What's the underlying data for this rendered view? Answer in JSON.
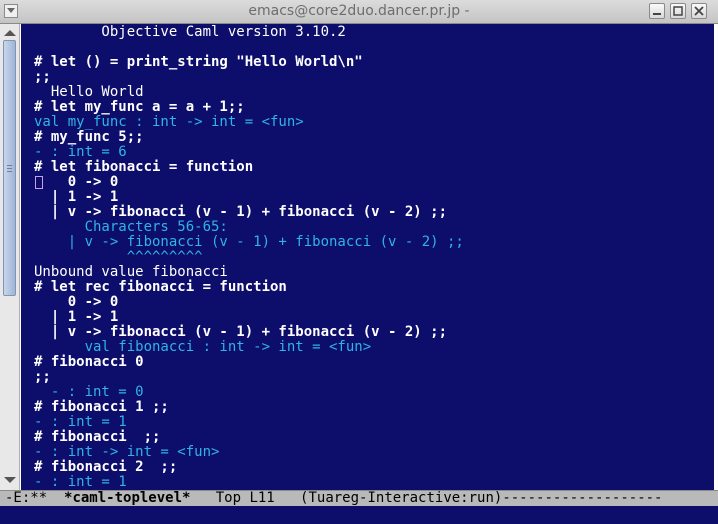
{
  "window": {
    "title": "emacs@core2duo.dancer.pr.jp -"
  },
  "buffer": {
    "lines": [
      {
        "text": "        Objective Caml version 3.10.2",
        "kind": "out"
      },
      {
        "text": "",
        "kind": "out"
      },
      {
        "text": "# let () = print_string \"Hello World\\n\"",
        "kind": "inp"
      },
      {
        "text": ";;",
        "kind": "inp"
      },
      {
        "text": "  Hello World",
        "kind": "out"
      },
      {
        "text": "# let my_func a = a + 1;;",
        "kind": "inp"
      },
      {
        "text": "val my_func : int -> int = <fun>",
        "kind": "typ"
      },
      {
        "text": "# my_func 5;;",
        "kind": "inp"
      },
      {
        "text": "- : int = 6",
        "kind": "typ"
      },
      {
        "text": "# let fibonacci = function",
        "kind": "inp"
      },
      {
        "text": "    0 -> 0",
        "kind": "inp"
      },
      {
        "text": "  | 1 -> 1",
        "kind": "inp"
      },
      {
        "text": "  | v -> fibonacci (v - 1) + fibonacci (v - 2) ;;",
        "kind": "inp"
      },
      {
        "text": "      Characters 56-65:",
        "kind": "typ"
      },
      {
        "text": "    | v -> fibonacci (v - 1) + fibonacci (v - 2) ;;",
        "kind": "typ"
      },
      {
        "text": "           ^^^^^^^^^",
        "kind": "typ"
      },
      {
        "text": "Unbound value fibonacci",
        "kind": "out"
      },
      {
        "text": "# let rec fibonacci = function",
        "kind": "inp"
      },
      {
        "text": "    0 -> 0",
        "kind": "inp"
      },
      {
        "text": "  | 1 -> 1",
        "kind": "inp"
      },
      {
        "text": "  | v -> fibonacci (v - 1) + fibonacci (v - 2) ;;",
        "kind": "inp"
      },
      {
        "text": "      val fibonacci : int -> int = <fun>",
        "kind": "typ"
      },
      {
        "text": "# fibonacci 0",
        "kind": "inp"
      },
      {
        "text": ";;",
        "kind": "inp"
      },
      {
        "text": "  - : int = 0",
        "kind": "typ"
      },
      {
        "text": "# fibonacci 1 ;;",
        "kind": "inp"
      },
      {
        "text": "- : int = 1",
        "kind": "typ"
      },
      {
        "text": "# fibonacci  ;;",
        "kind": "inp"
      },
      {
        "text": "- : int -> int = <fun>",
        "kind": "typ"
      },
      {
        "text": "# fibonacci 2  ;;",
        "kind": "inp"
      },
      {
        "text": "- : int = 1",
        "kind": "typ"
      }
    ]
  },
  "modeline": {
    "flags": "-E:**  ",
    "buffer_name": "*caml-toplevel*",
    "position": "   Top L11   ",
    "mode": "(Tuareg-Interactive:run)",
    "fill": "-------------------"
  },
  "minibuffer": {
    "text": ""
  },
  "colors": {
    "background": "#0d0d6b",
    "foreground": "#ffffff",
    "type_output": "#2fb4e6",
    "modeline_bg": "#b9b9b9"
  },
  "icons": [
    "window-menu-icon",
    "minimize-icon",
    "maximize-icon",
    "close-icon",
    "scroll-up-icon",
    "scroll-down-icon"
  ]
}
